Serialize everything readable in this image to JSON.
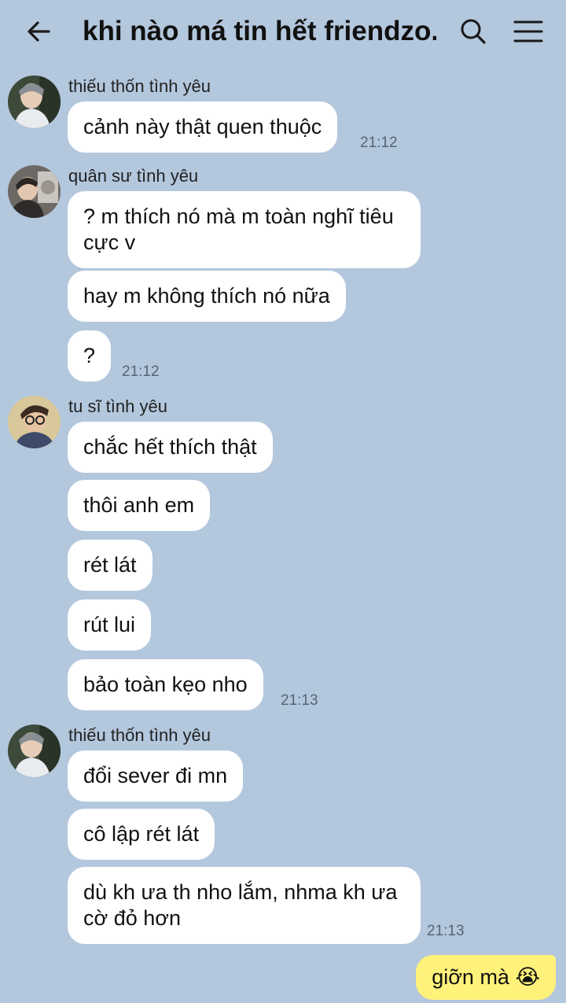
{
  "header": {
    "title": "khi nào má tin hết friendzo...",
    "back_icon": "arrow-left-icon",
    "search_icon": "search-icon",
    "menu_icon": "hamburger-menu-icon"
  },
  "groups": [
    {
      "sender": "thiếu thốn tình yêu",
      "messages": [
        "cảnh này thật quen thuộc"
      ],
      "time": "21:12"
    },
    {
      "sender": "quân sư tình yêu",
      "messages": [
        "? m thích nó mà m toàn nghĩ tiêu cực v",
        "hay m không thích nó nữa",
        "?"
      ],
      "time": "21:12"
    },
    {
      "sender": "tu sĩ tình yêu",
      "messages": [
        "chắc hết thích thật",
        "thôi anh em",
        "rét lát",
        "rút lui",
        "bảo toàn kẹo nho"
      ],
      "time": "21:13"
    },
    {
      "sender": "thiếu thốn tình yêu",
      "messages": [
        "đổi sever đi mn",
        "cô lập rét lát",
        "dù kh ưa th nho lắm, nhma kh ưa cờ đỏ hơn"
      ],
      "time": "21:13"
    }
  ],
  "outgoing": {
    "text": "giỡn mà 😭"
  },
  "colors": {
    "background": "#b3c7dd",
    "incoming_bubble": "#ffffff",
    "outgoing_bubble": "#fff27a"
  }
}
